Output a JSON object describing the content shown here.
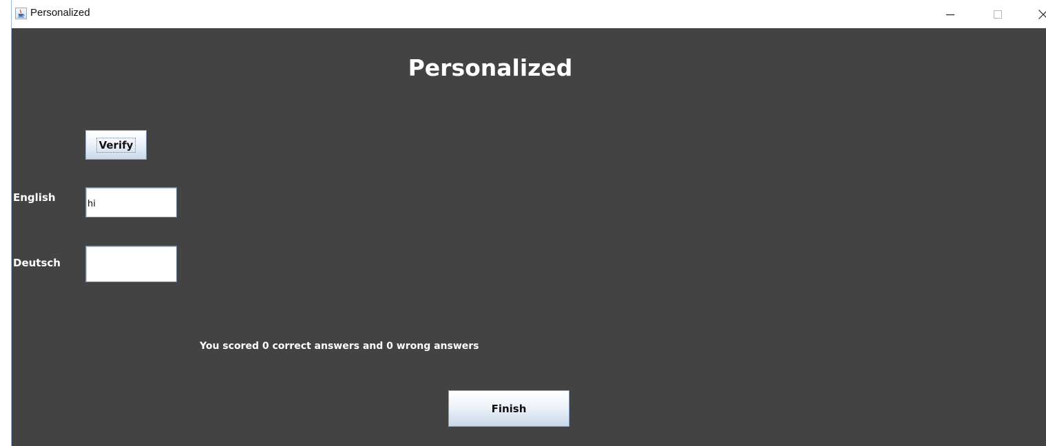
{
  "window": {
    "title": "Personalized",
    "controls": {
      "minimize": "—",
      "maximize": "□",
      "close": "X"
    }
  },
  "main": {
    "heading": "Personalized",
    "verify_button_label": "Verify",
    "english": {
      "label": "English",
      "value": "hi"
    },
    "deutsch": {
      "label": "Deutsch",
      "value": ""
    },
    "score_text": "You scored 0 correct answers and 0 wrong answers",
    "finish_button_label": "Finish"
  },
  "colors": {
    "background": "#434343",
    "text": "#ffffff",
    "button_gradient_top": "#ffffff",
    "button_gradient_bottom": "#c9d8ea"
  },
  "icons": {
    "app": "java-coffee-cup-icon"
  }
}
